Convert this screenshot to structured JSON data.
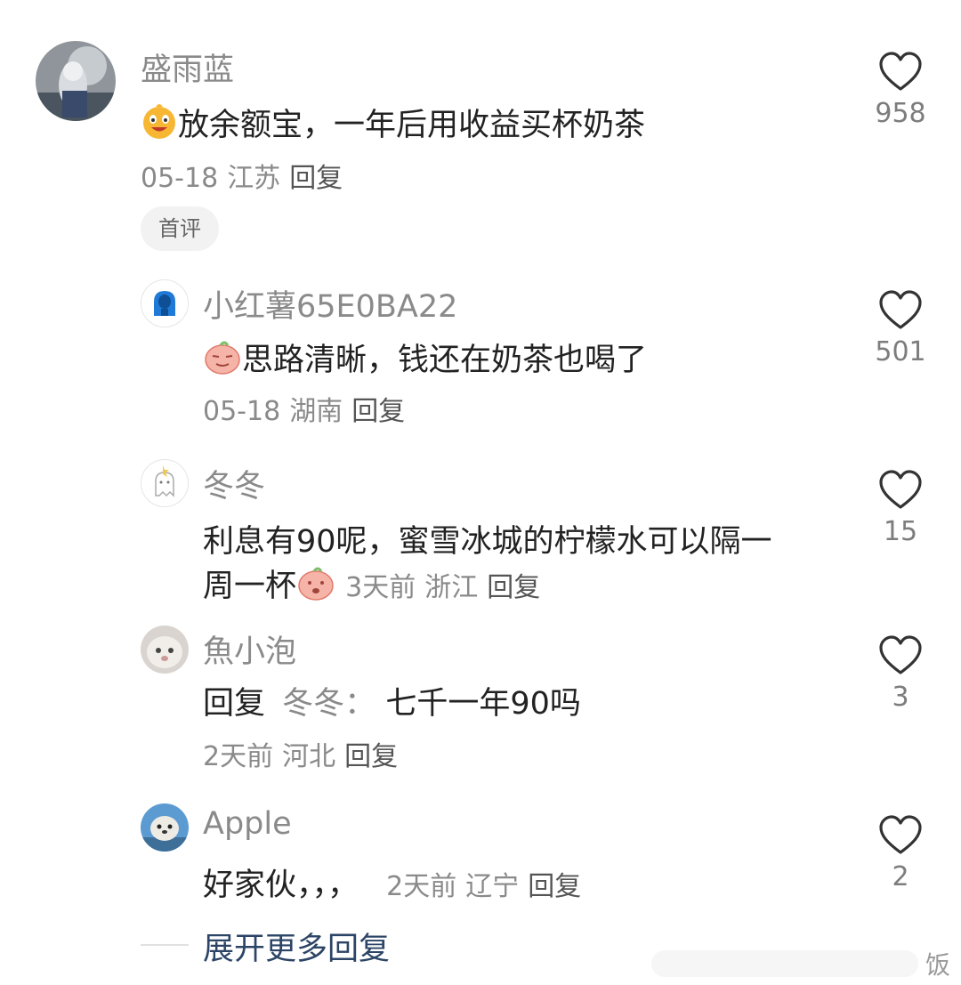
{
  "comments": {
    "main": {
      "username": "盛雨蓝",
      "text": "放余额宝，一年后用收益买杯奶茶",
      "date": "05-18",
      "location": "江苏",
      "reply_label": "回复",
      "likes": "958",
      "badge": "首评"
    },
    "replies": [
      {
        "username": "小红薯65E0BA22",
        "text": "思路清晰，钱还在奶茶也喝了",
        "date": "05-18",
        "location": "湖南",
        "reply_label": "回复",
        "likes": "501"
      },
      {
        "username": "冬冬",
        "text_line1": "利息有90呢，蜜雪冰城的柠檬水可以隔一",
        "text_line2": "周一杯",
        "date": "3天前",
        "location": "浙江",
        "reply_label": "回复",
        "likes": "15"
      },
      {
        "username": "魚小泡",
        "reply_prefix": "回复",
        "reply_to": "冬冬：",
        "text": "七千一年90吗",
        "date": "2天前",
        "location": "河北",
        "reply_label": "回复",
        "likes": "3"
      },
      {
        "username": "Apple",
        "text": "好家伙，，，",
        "date": "2天前",
        "location": "辽宁",
        "reply_label": "回复",
        "likes": "2"
      }
    ]
  },
  "expand_label": "展开更多回复",
  "watermark_text": "饭",
  "colors": {
    "name": "#8a8a8a",
    "text": "#222222",
    "link": "#2c4466",
    "badge_bg": "#f2f2f2"
  },
  "icons": [
    "heart-outline-icon",
    "emoji-face-icon"
  ]
}
